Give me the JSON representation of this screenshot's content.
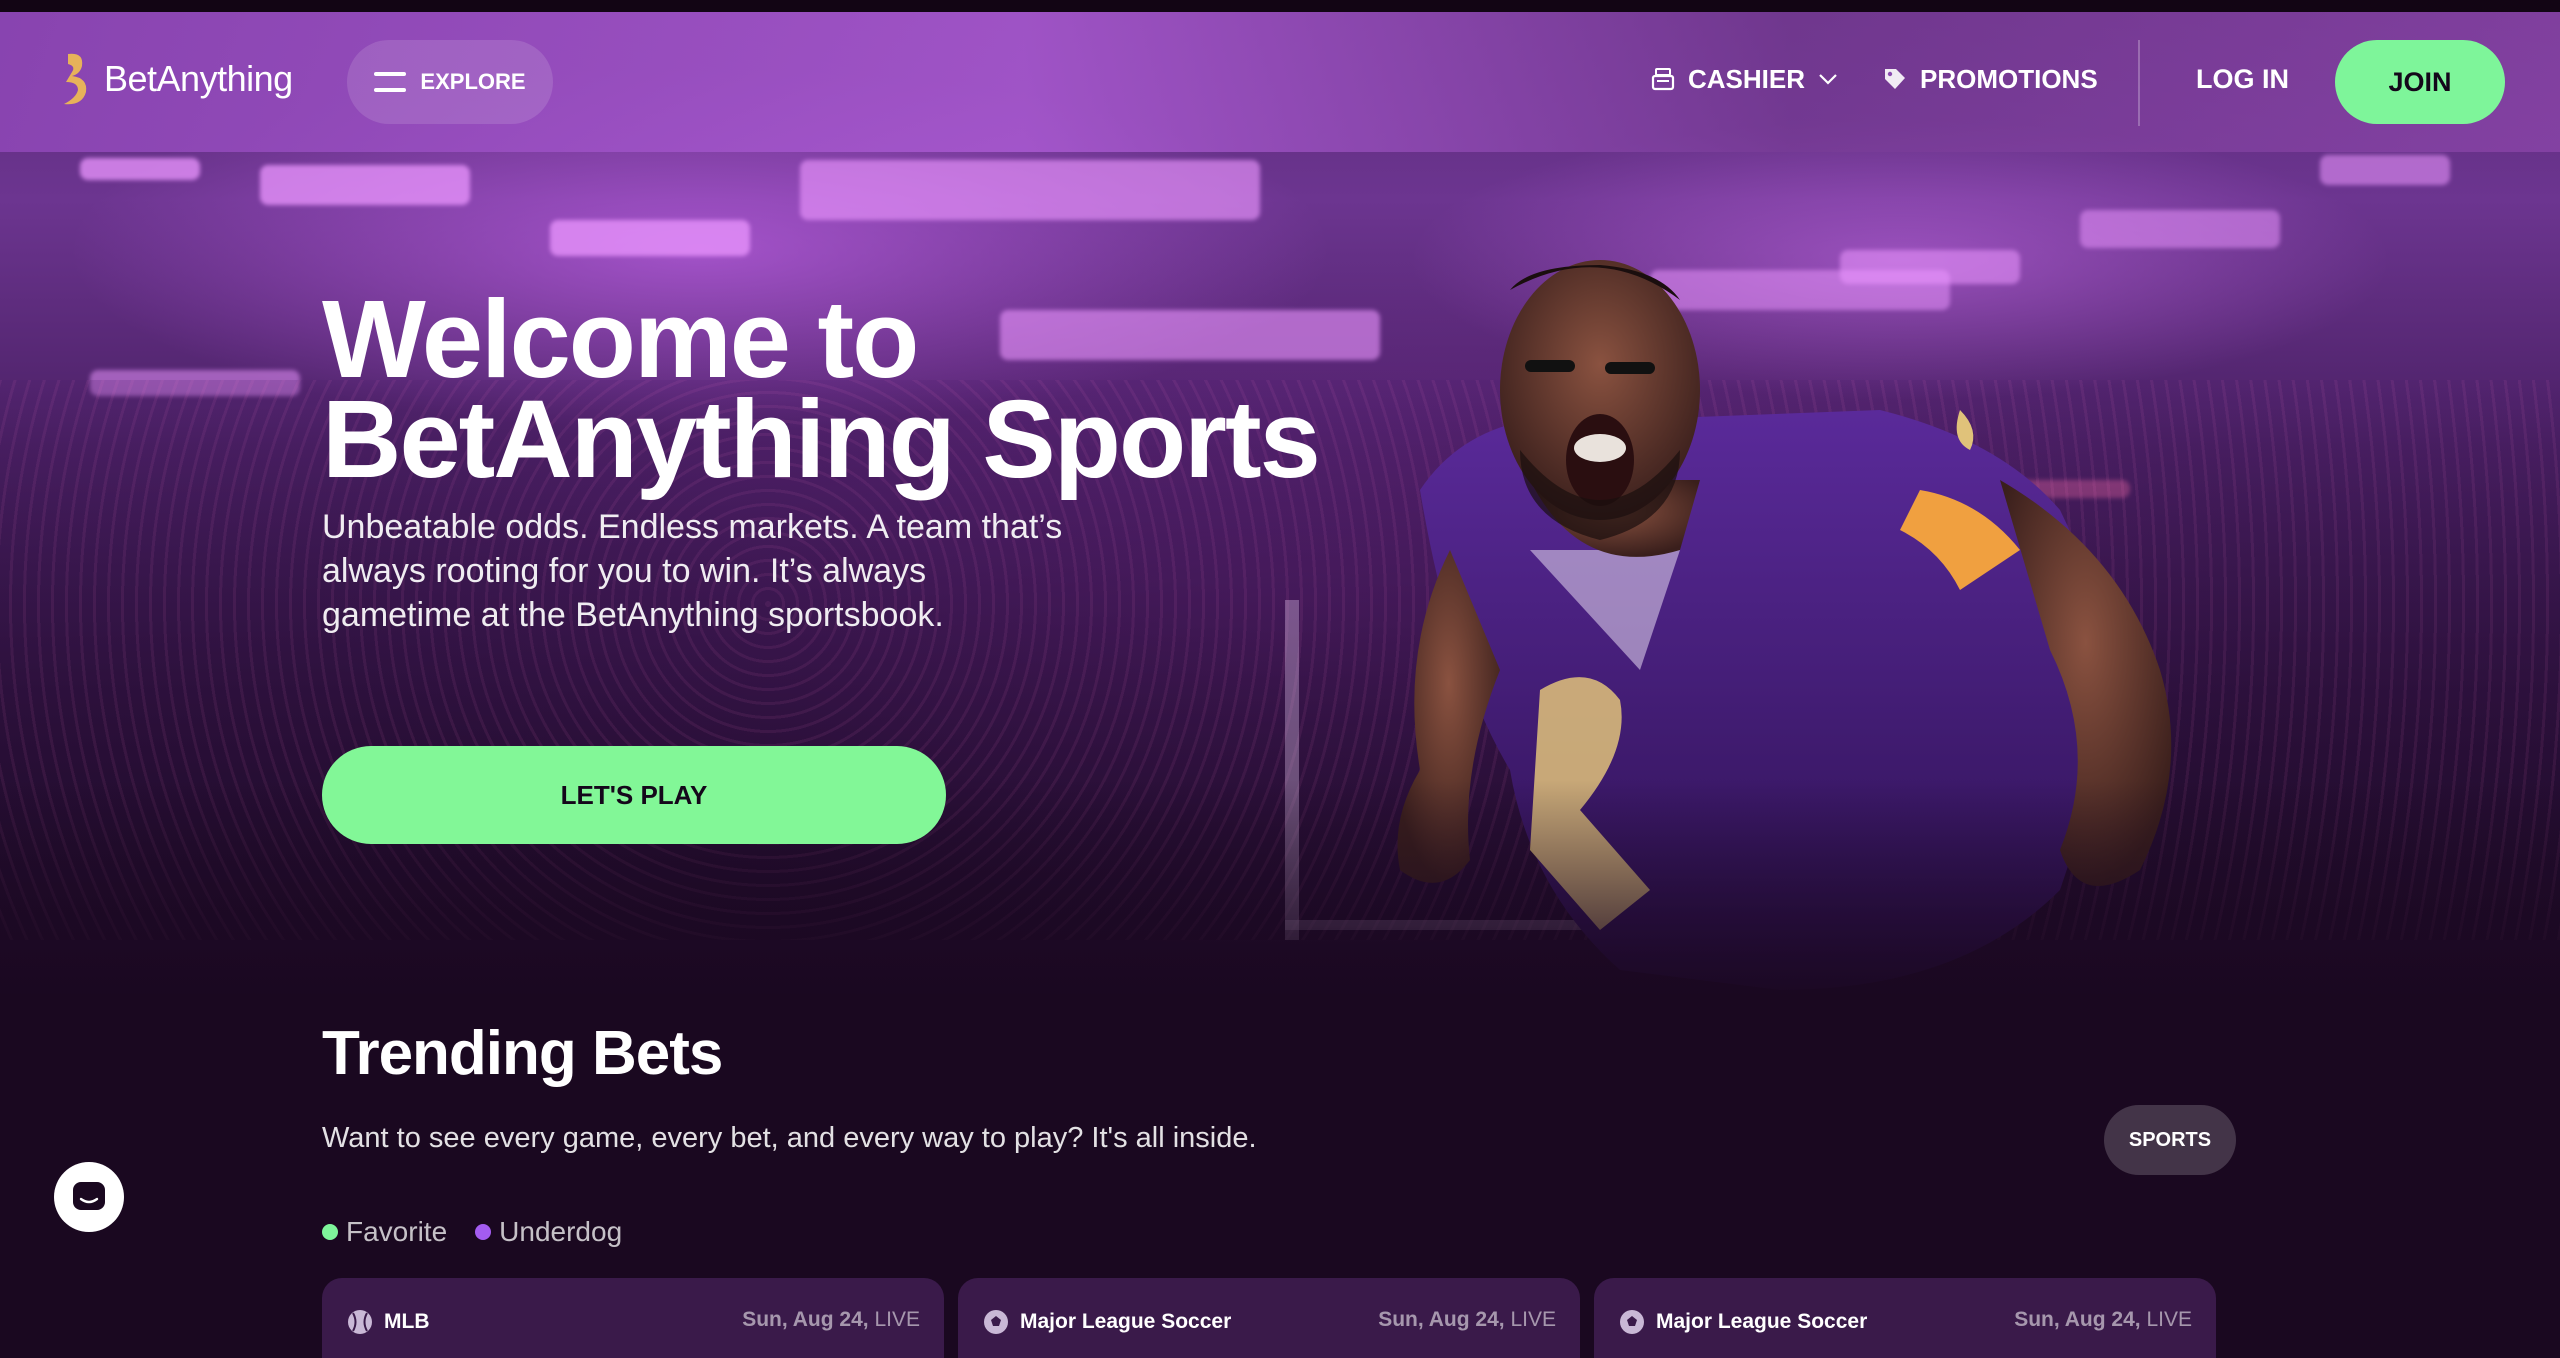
{
  "header": {
    "logo_text": "BetAnything",
    "explore_label": "EXPLORE",
    "cashier_label": "CASHIER",
    "promotions_label": "PROMOTIONS",
    "login_label": "LOG IN",
    "join_label": "JOIN"
  },
  "hero": {
    "title_line1": "Welcome to",
    "title_line2": "BetAnything Sports",
    "subtitle_line1": "Unbeatable odds. Endless markets. A team that’s",
    "subtitle_line2": "always rooting for you to win. It’s always",
    "subtitle_line3": "gametime at the BetAnything sportsbook.",
    "cta_label": "LET'S PLAY"
  },
  "trending": {
    "title": "Trending Bets",
    "subtitle": "Want to see every game, every bet, and every way to play? It's all inside.",
    "sports_button": "SPORTS",
    "legend": [
      {
        "label": "Favorite",
        "color": "#7ef59a"
      },
      {
        "label": "Underdog",
        "color": "#a35cf0"
      }
    ],
    "cards": [
      {
        "league": "MLB",
        "icon": "baseball-icon",
        "date": "Sun, Aug 24,",
        "status": "LIVE"
      },
      {
        "league": "Major League Soccer",
        "icon": "soccer-ball-icon",
        "date": "Sun, Aug 24,",
        "status": "LIVE"
      },
      {
        "league": "Major League Soccer",
        "icon": "soccer-ball-icon",
        "date": "Sun, Aug 24,",
        "status": "LIVE"
      }
    ]
  },
  "colors": {
    "accent_green": "#7ef59a",
    "background": "#1a0820",
    "card_bg": "#3a1a4a"
  }
}
